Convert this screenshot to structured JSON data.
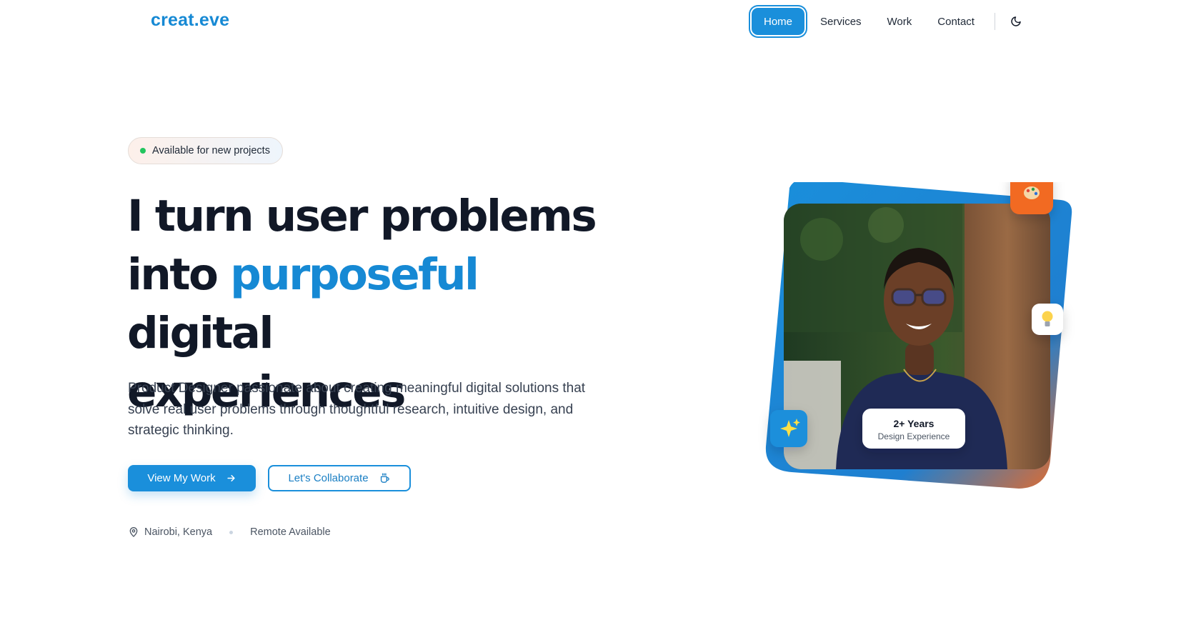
{
  "brand": {
    "logo": "creat.eve",
    "accent": "#1689d4"
  },
  "nav": {
    "items": [
      {
        "label": "Home",
        "active": true
      },
      {
        "label": "Services",
        "active": false
      },
      {
        "label": "Work",
        "active": false
      },
      {
        "label": "Contact",
        "active": false
      }
    ],
    "theme_toggle_icon": "moon-icon"
  },
  "hero": {
    "badge": {
      "text": "Available for new projects",
      "dot_color": "#22c55e"
    },
    "headline": {
      "line1": "I turn user problems",
      "line2_before": "into ",
      "line2_accent": "purposeful",
      "line2_after": " digital",
      "line3": "experiences"
    },
    "lead": "Product Designer passionate about creating meaningful digital solutions that solve real user problems through thoughtful research, intuitive design, and strategic thinking.",
    "primary_button": {
      "label": "View My Work",
      "icon": "arrow-right-icon"
    },
    "secondary_button": {
      "label": "Let's Collaborate",
      "icon": "coffee-cup-icon"
    },
    "location": {
      "icon": "map-pin-icon",
      "text": "Nairobi, Kenya"
    },
    "availability": "Remote Available",
    "stat": {
      "value": "2+ Years",
      "label": "Design Experience"
    },
    "floating_icons": [
      "palette-icon",
      "lightbulb-icon",
      "sparkles-icon"
    ],
    "colors": {
      "primary": "#1a8fdb",
      "orange": "#f26a21",
      "heading": "#111827"
    }
  }
}
